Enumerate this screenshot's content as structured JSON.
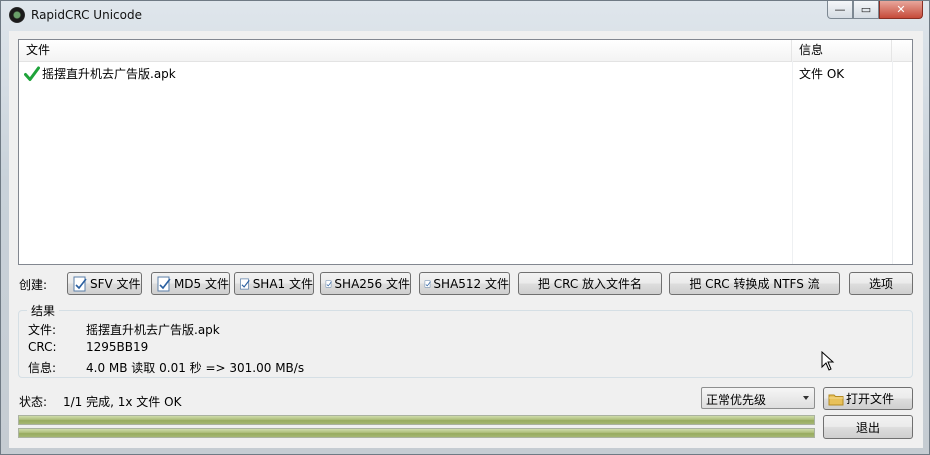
{
  "window": {
    "title": "RapidCRC Unicode",
    "min_symbol": "—",
    "max_symbol": "▭",
    "close_symbol": "✕"
  },
  "list": {
    "columns": [
      "文件",
      "信息"
    ],
    "rows": [
      {
        "file": "摇摆直升机去广告版.apk",
        "info": "文件 OK",
        "status_icon": "check-icon"
      }
    ]
  },
  "create": {
    "label": "创建:",
    "buttons": {
      "sfv": "SFV 文件",
      "md5": "MD5 文件",
      "sha1": "SHA1 文件",
      "sha256": "SHA256 文件",
      "sha512": "SHA512 文件",
      "crc_filename": "把 CRC 放入文件名",
      "crc_ntfs": "把 CRC 转换成 NTFS 流",
      "options": "选项"
    }
  },
  "results": {
    "title": "结果",
    "file_label": "文件:",
    "file_value": "摇摆直升机去广告版.apk",
    "crc_label": "CRC:",
    "crc_value": "1295BB19",
    "info_label": "信息:",
    "info_value": "4.0 MB 读取 0.01 秒 => 301.00 MB/s"
  },
  "status": {
    "label": "状态:",
    "value": "1/1 完成, 1x 文件 OK"
  },
  "priority": {
    "selected": "正常优先级"
  },
  "actions": {
    "open_files": "打开文件",
    "exit": "退出"
  },
  "progress": {
    "file": 1.0,
    "total": 1.0
  },
  "colors": {
    "check": "#1fa33a",
    "progress_fill": "#a8bb74"
  }
}
